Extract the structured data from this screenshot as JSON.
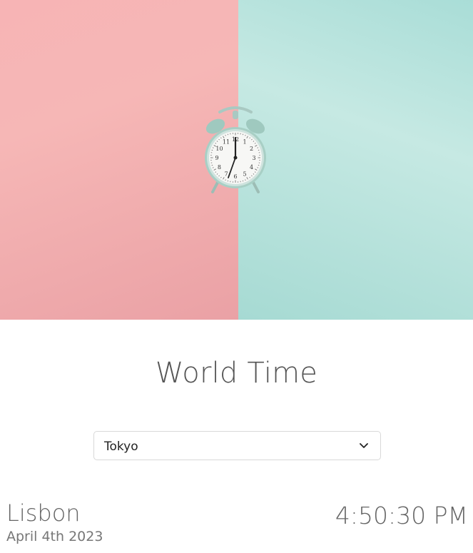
{
  "header": {
    "title": "World Time"
  },
  "city_select": {
    "selected": "Tokyo",
    "icon": "chevron-down-icon"
  },
  "result": {
    "city": "Lisbon",
    "date": "April 4th 2023",
    "time": "4:50:30 PM"
  },
  "hero": {
    "left_color": "#f6b7b6",
    "right_color": "#b7e3dd",
    "clock_numerals": [
      "12",
      "1",
      "2",
      "3",
      "4",
      "5",
      "6",
      "7",
      "8",
      "9",
      "10",
      "11"
    ]
  }
}
